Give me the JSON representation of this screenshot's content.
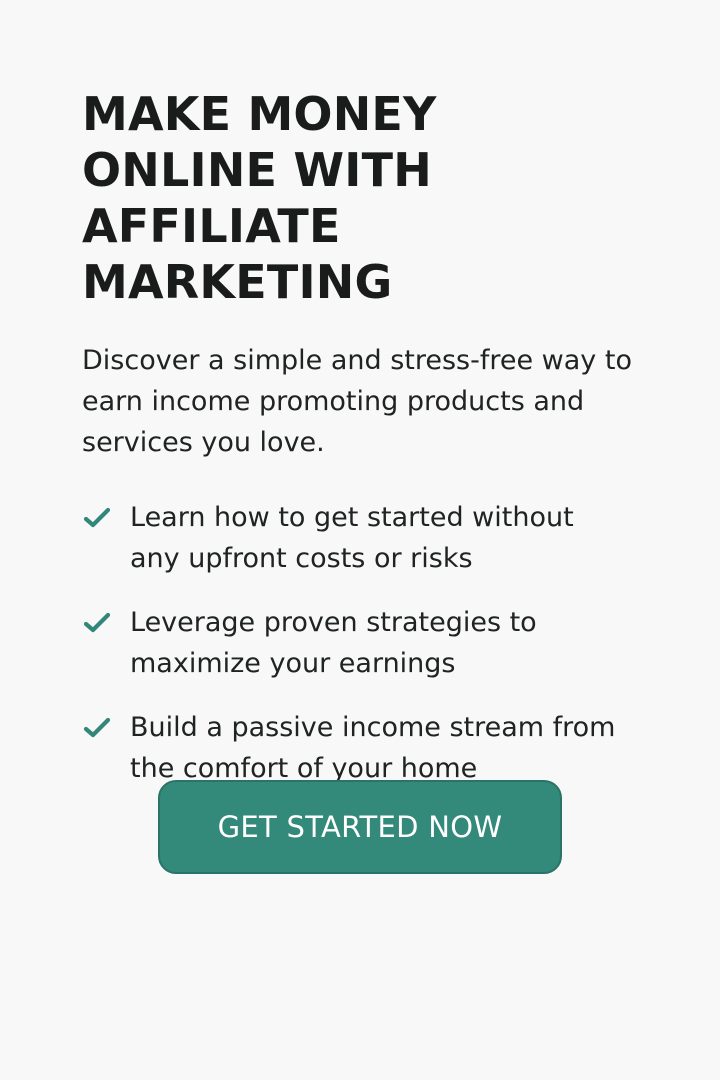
{
  "hero": {
    "headline": "MAKE MONEY ONLINE WITH AFFILIATE MARKETING",
    "intro": "Discover a simple and stress-free way to earn income promoting products and services you love."
  },
  "benefits": [
    {
      "icon": "check-icon",
      "text": "Learn how to get started without any upfront costs or risks"
    },
    {
      "icon": "check-icon",
      "text": "Leverage proven strategies to maximize your earnings"
    },
    {
      "icon": "check-icon",
      "text": "Build a passive income stream from the comfort of your home"
    }
  ],
  "cta": {
    "label": "GET STARTED NOW"
  },
  "colors": {
    "background": "#f8f8f8",
    "text": "#1a1c1c",
    "accent": "#33897a"
  }
}
